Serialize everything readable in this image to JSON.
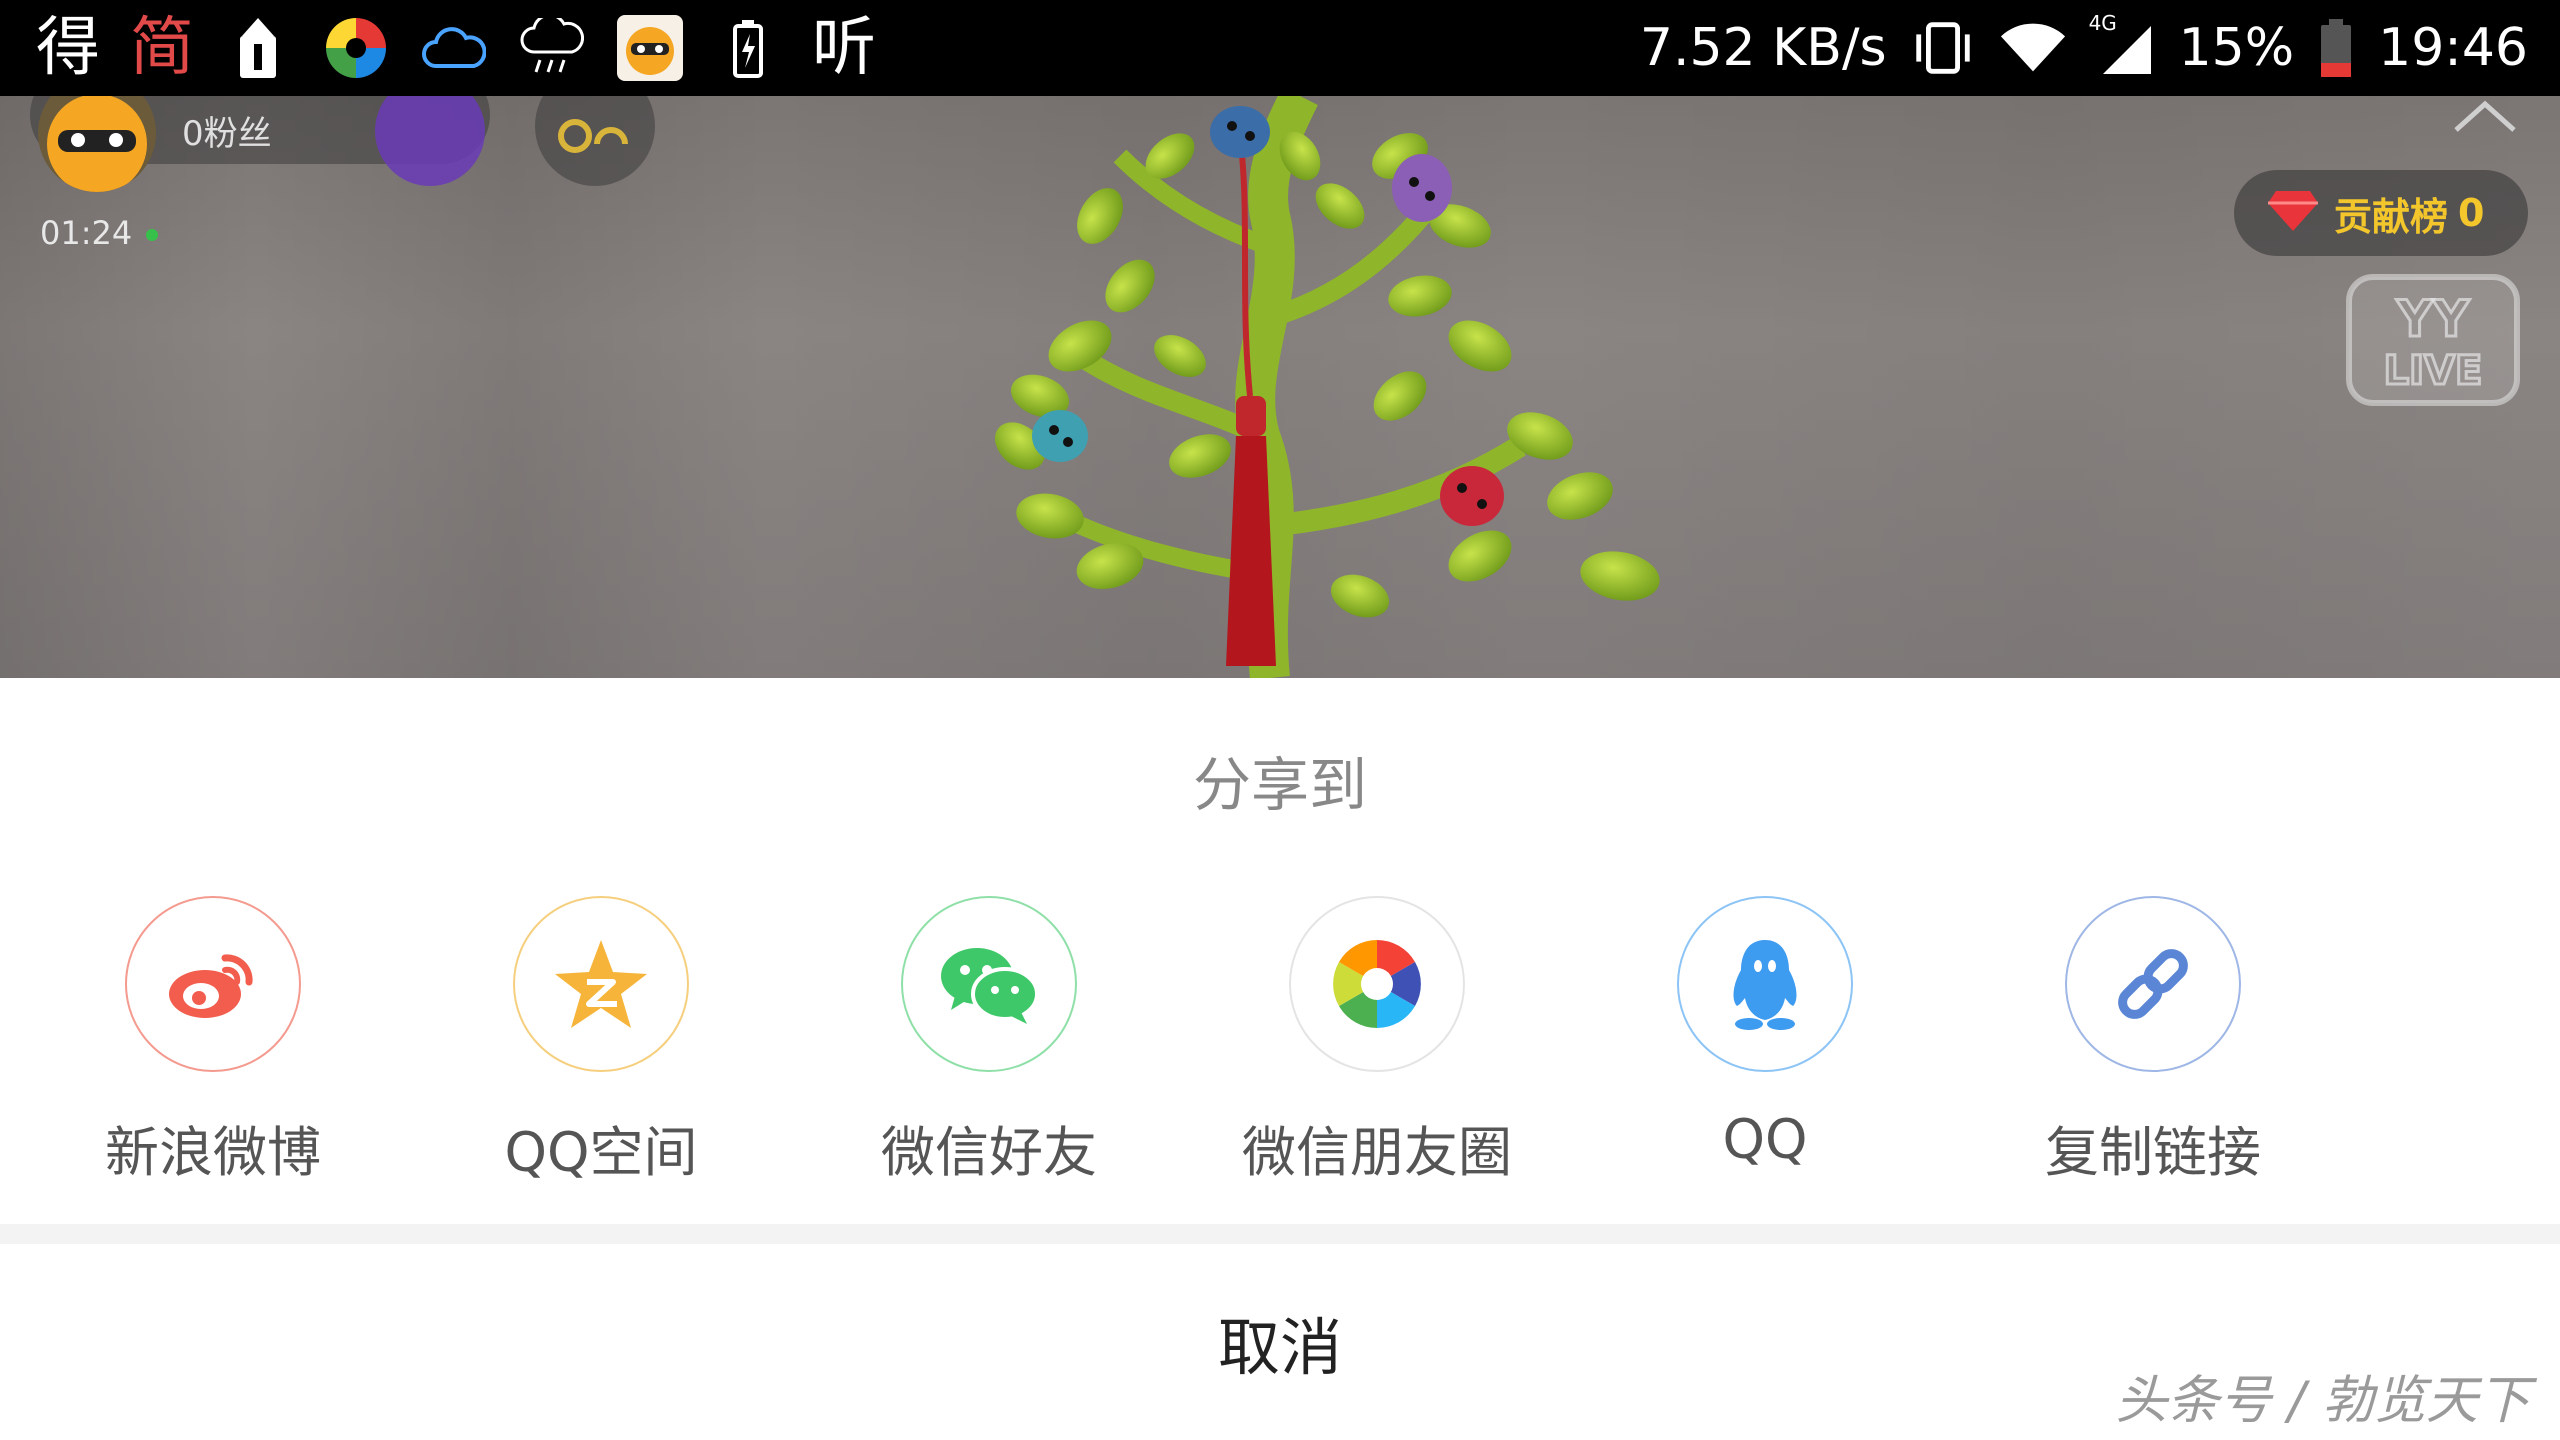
{
  "status_bar": {
    "left_glyphs": [
      "得",
      "简",
      "听"
    ],
    "net_speed": "7.52 KB/s",
    "network_type": "4G",
    "battery_percent": "15%",
    "time": "19:46"
  },
  "live": {
    "fans_text": "0粉丝",
    "elapsed": "01:24",
    "rank_label": "贡献榜",
    "rank_count": "0",
    "logo_line1": "YY",
    "logo_line2": "LIVE"
  },
  "share_sheet": {
    "title": "分享到",
    "targets": [
      {
        "label": "新浪微博",
        "icon": "weibo-icon",
        "color": "#f25d4d"
      },
      {
        "label": "QQ空间",
        "icon": "qzone-icon",
        "color": "#f6b53a"
      },
      {
        "label": "微信好友",
        "icon": "wechat-icon",
        "color": "#3fc86a"
      },
      {
        "label": "微信朋友圈",
        "icon": "moments-icon",
        "color": "#cccccc"
      },
      {
        "label": "QQ",
        "icon": "qq-penguin-icon",
        "color": "#3d9bf0"
      },
      {
        "label": "复制链接",
        "icon": "link-icon",
        "color": "#5b86d6"
      }
    ],
    "cancel_label": "取消"
  },
  "watermark": "头条号 / 勃览天下"
}
